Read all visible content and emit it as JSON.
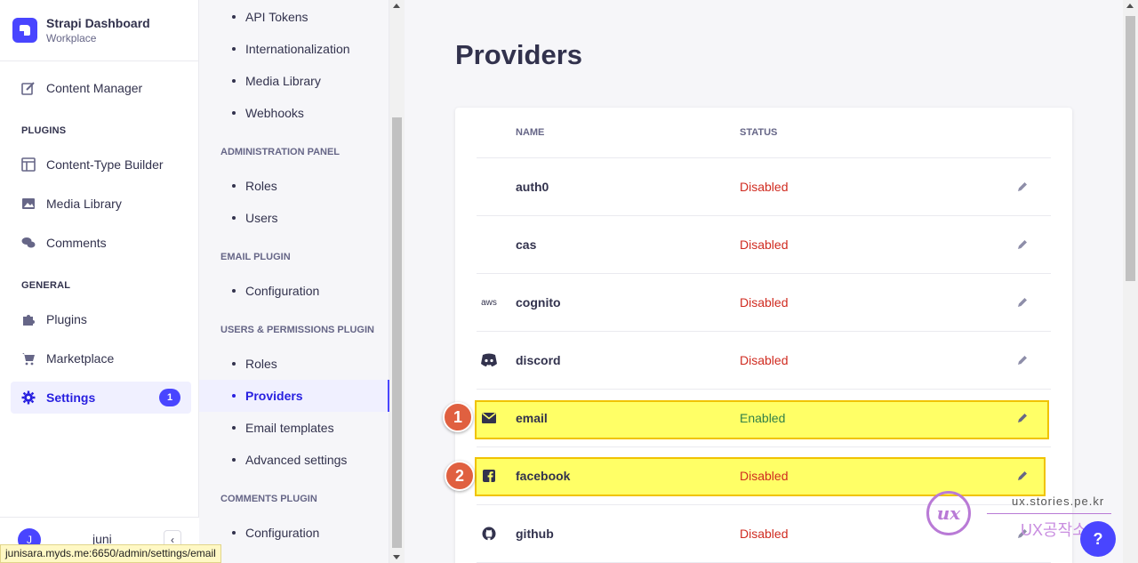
{
  "brand": {
    "title": "Strapi Dashboard",
    "subtitle": "Workplace"
  },
  "nav": {
    "content_manager": "Content Manager",
    "plugins_section": "PLUGINS",
    "content_type_builder": "Content-Type Builder",
    "media_library": "Media Library",
    "comments": "Comments",
    "general_section": "GENERAL",
    "plugins": "Plugins",
    "marketplace": "Marketplace",
    "settings": "Settings",
    "settings_badge": "1"
  },
  "user": {
    "initial": "J",
    "name": "juni",
    "collapse_icon": "‹"
  },
  "subnav": {
    "top_items": [
      "API Tokens",
      "Internationalization",
      "Media Library",
      "Webhooks"
    ],
    "admin_section": "ADMINISTRATION PANEL",
    "admin_items": [
      "Roles",
      "Users"
    ],
    "email_section": "EMAIL PLUGIN",
    "email_items": [
      "Configuration"
    ],
    "up_section": "USERS & PERMISSIONS PLUGIN",
    "up_items": [
      "Roles",
      "Providers",
      "Email templates",
      "Advanced settings"
    ],
    "comments_section": "COMMENTS PLUGIN",
    "comments_items": [
      "Configuration"
    ]
  },
  "page": {
    "title": "Providers"
  },
  "table": {
    "headers": {
      "name": "NAME",
      "status": "STATUS"
    },
    "rows": [
      {
        "icon": "",
        "name": "auth0",
        "status": "Disabled"
      },
      {
        "icon": "aws-icon",
        "name": "cas",
        "status": "Disabled"
      },
      {
        "icon": "aws",
        "name": "cognito",
        "status": "Disabled"
      },
      {
        "icon": "discord-icon",
        "name": "discord",
        "status": "Disabled"
      },
      {
        "icon": "envelope-icon",
        "name": "email",
        "status": "Enabled"
      },
      {
        "icon": "facebook-icon",
        "name": "facebook",
        "status": "Disabled"
      },
      {
        "icon": "github-icon",
        "name": "github",
        "status": "Disabled"
      }
    ]
  },
  "annotations": {
    "marker1": "1",
    "marker2": "2"
  },
  "status_url": "junisara.myds.me:6650/admin/settings/email",
  "watermark": {
    "logo": "ux",
    "url": "ux.stories.pe.kr",
    "brand": "UX공작소"
  },
  "help": "?",
  "colors": {
    "accent": "#4945ff",
    "disabled": "#d02b20",
    "enabled": "#328048",
    "highlight": "#ffff66"
  }
}
